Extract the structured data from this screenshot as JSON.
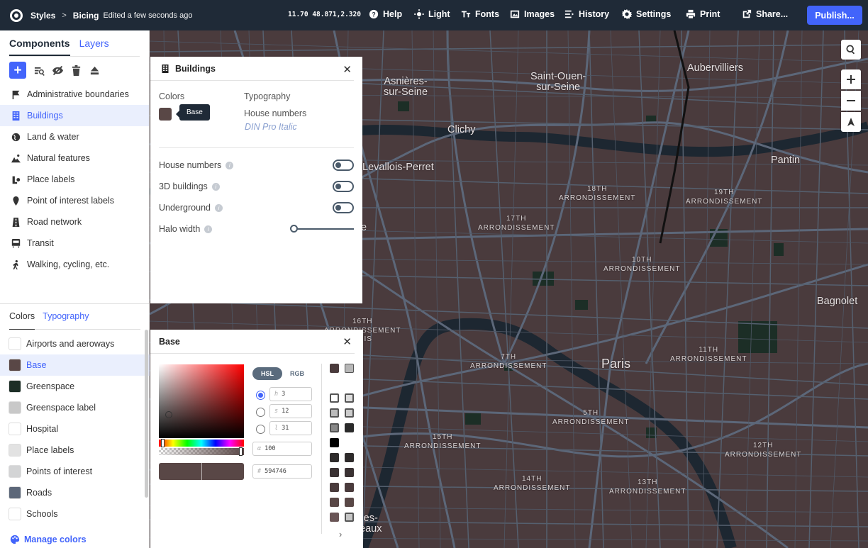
{
  "topbar": {
    "app": "Styles",
    "separator": ">",
    "style_name": "Bicing",
    "edited": "Edited a few seconds ago",
    "coords": "11.70 48.871,2.320",
    "nav": {
      "help": "Help",
      "light": "Light",
      "fonts": "Fonts",
      "images": "Images",
      "history": "History",
      "settings": "Settings",
      "print": "Print",
      "share": "Share..."
    },
    "publish": "Publish..."
  },
  "left": {
    "tabs": [
      "Components",
      "Layers"
    ],
    "components": [
      {
        "label": "Administrative boundaries",
        "icon": "flag-icon"
      },
      {
        "label": "Buildings",
        "icon": "building-icon"
      },
      {
        "label": "Land & water",
        "icon": "globe-icon"
      },
      {
        "label": "Natural features",
        "icon": "mountain-icon"
      },
      {
        "label": "Place labels",
        "icon": "place-label-icon"
      },
      {
        "label": "Point of interest labels",
        "icon": "pin-icon"
      },
      {
        "label": "Road network",
        "icon": "road-icon"
      },
      {
        "label": "Transit",
        "icon": "transit-icon"
      },
      {
        "label": "Walking, cycling, etc.",
        "icon": "walking-icon"
      }
    ],
    "lower_tabs": [
      "Colors",
      "Typography"
    ],
    "colors": [
      {
        "label": "Airports and aeroways",
        "color": "#ffffff"
      },
      {
        "label": "Base",
        "color": "#594746"
      },
      {
        "label": "Greenspace",
        "color": "#1c2e26"
      },
      {
        "label": "Greenspace label",
        "color": "#c8c8c8"
      },
      {
        "label": "Hospital",
        "color": "#ffffff"
      },
      {
        "label": "Place labels",
        "color": "#e2e2e2"
      },
      {
        "label": "Points of interest",
        "color": "#d3d4d5"
      },
      {
        "label": "Roads",
        "color": "#5c6779"
      },
      {
        "label": "Schools",
        "color": "#ffffff"
      }
    ],
    "manage": "Manage colors"
  },
  "buildings": {
    "title": "Buildings",
    "colors_label": "Colors",
    "typography_label": "Typography",
    "base_tooltip": "Base",
    "house_numbers_font_label": "House numbers",
    "font_name": "DIN Pro Italic",
    "options": [
      "House numbers",
      "3D buildings",
      "Underground"
    ],
    "halo": "Halo width",
    "info": "i"
  },
  "base_panel": {
    "title": "Base",
    "modes": [
      "HSL",
      "RGB"
    ],
    "h": "3",
    "s": "12",
    "l": "31",
    "alpha": "100",
    "hex": "594746",
    "prefix_h": "h",
    "prefix_s": "s",
    "prefix_l": "l",
    "prefix_a": "α",
    "prefix_hex": "#"
  },
  "map": {
    "labels": [
      "Asnières-sur-Seine",
      "Saint-Ouen-sur-Seine",
      "Aubervilliers",
      "Clichy",
      "Pantin",
      "Levallois-Perret",
      "Bagnolet",
      "Paris"
    ],
    "arrondissements": [
      "18TH ARRONDISSEMENT",
      "19TH ARRONDISSEMENT",
      "17TH ARRONDISSEMENT",
      "10TH ARRONDISSEMENT",
      "16TH ARRONDISSEMENT",
      "7TH ARRONDISSEMENT",
      "11TH ARRONDISSEMENT",
      "5TH ARRONDISSEMENT",
      "15TH ARRONDISSEMENT",
      "12TH ARRONDISSEMENT",
      "14TH ARRONDISSEMENT",
      "13TH ARRONDISSEMENT"
    ],
    "clipped": [
      "e",
      "ARIS",
      "es-",
      "eaux"
    ]
  },
  "colors": {
    "accent": "#4264fb",
    "topbar": "#1f2a37",
    "base": "#594746",
    "roads": "#5c6779",
    "water": "#1d2731"
  }
}
